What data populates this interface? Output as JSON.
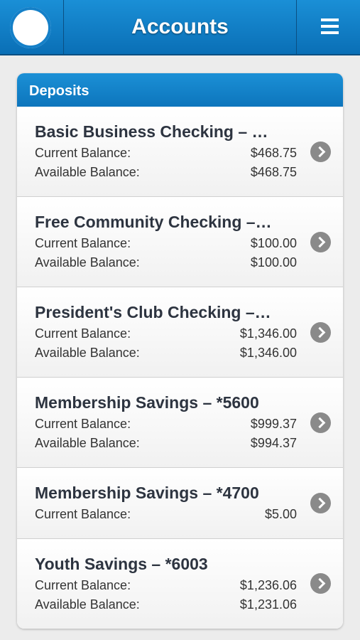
{
  "header": {
    "title": "Accounts",
    "logo_icon": "circle-logo-icon",
    "menu_icon": "hamburger-menu-icon"
  },
  "section": {
    "title": "Deposits",
    "accounts": [
      {
        "name": "Basic Business Checking – …",
        "lines": [
          {
            "label": "Current Balance:",
            "value": "$468.75"
          },
          {
            "label": "Available Balance:",
            "value": "$468.75"
          }
        ]
      },
      {
        "name": "Free Community Checking –…",
        "lines": [
          {
            "label": "Current Balance:",
            "value": "$100.00"
          },
          {
            "label": "Available Balance:",
            "value": "$100.00"
          }
        ]
      },
      {
        "name": "President's Club Checking –…",
        "lines": [
          {
            "label": "Current Balance:",
            "value": "$1,346.00"
          },
          {
            "label": "Available Balance:",
            "value": "$1,346.00"
          }
        ]
      },
      {
        "name": "Membership Savings – *5600",
        "lines": [
          {
            "label": "Current Balance:",
            "value": "$999.37"
          },
          {
            "label": "Available Balance:",
            "value": "$994.37"
          }
        ]
      },
      {
        "name": "Membership Savings – *4700",
        "lines": [
          {
            "label": "Current Balance:",
            "value": "$5.00"
          }
        ]
      },
      {
        "name": "Youth Savings – *6003",
        "lines": [
          {
            "label": "Current Balance:",
            "value": "$1,236.06"
          },
          {
            "label": "Available Balance:",
            "value": "$1,231.06"
          }
        ]
      }
    ]
  },
  "colors": {
    "header_blue": "#0d75bc",
    "text_dark": "#2d3440",
    "chevron_gray": "#8a8a8a"
  }
}
